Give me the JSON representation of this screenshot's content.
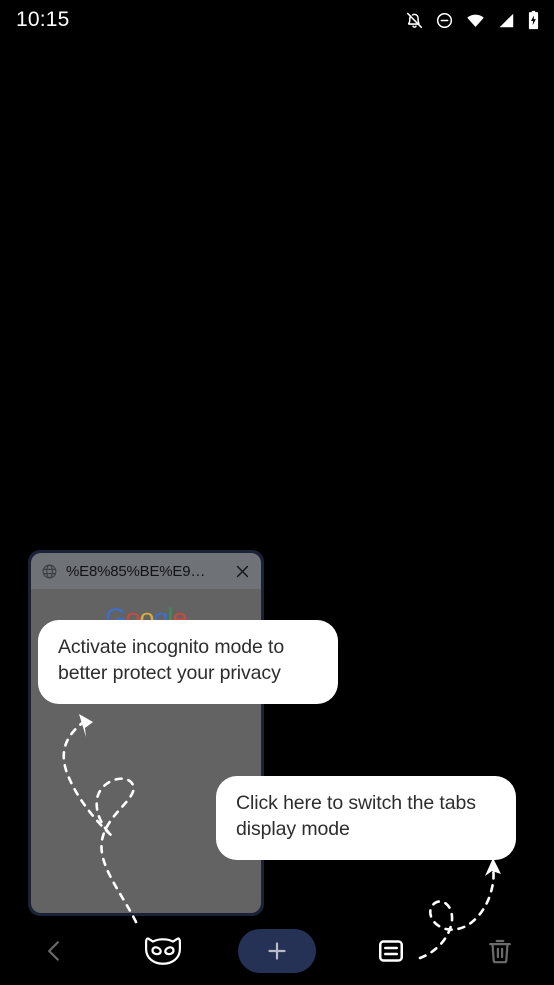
{
  "status_bar": {
    "time": "10:15",
    "icons": [
      {
        "name": "notifications-off-icon",
        "label": "Notifications silenced"
      },
      {
        "name": "do-not-disturb-icon",
        "label": "Do not disturb"
      },
      {
        "name": "wifi-icon",
        "label": "Wi-Fi full signal"
      },
      {
        "name": "cellular-signal-icon",
        "label": "Cellular signal"
      },
      {
        "name": "battery-charging-icon",
        "label": "Battery charging"
      }
    ]
  },
  "tab_card": {
    "favicon": "globe-icon",
    "title": "%E8%85%BE%E9…",
    "close_label": "✕",
    "thumbnail": {
      "logo_letters": [
        {
          "char": "G",
          "color": "#3b6fd4"
        },
        {
          "char": "o",
          "color": "#d0483c"
        },
        {
          "char": "o",
          "color": "#e0b33a"
        },
        {
          "char": "g",
          "color": "#3b6fd4"
        },
        {
          "char": "l",
          "color": "#3f9157"
        },
        {
          "char": "e",
          "color": "#d0483c"
        }
      ],
      "logo_subtext": "",
      "background_color": "#636363"
    },
    "border_color": "#1b2238",
    "header_color": "#6f7277"
  },
  "tooltips": [
    {
      "id": "incognito",
      "text": "Activate incognito mode to better protect your privacy",
      "background": "#ffffff",
      "text_color": "#2d2d2d",
      "points_to": "incognito-mode-button"
    },
    {
      "id": "tabs_display_mode",
      "text": "Click here to switch the tabs display mode",
      "background": "#ffffff",
      "text_color": "#2d2d2d",
      "points_to": "tabs-display-mode-button"
    }
  ],
  "bottom_toolbar": {
    "buttons": [
      {
        "name": "back-button",
        "icon": "chevron-left-icon",
        "color": "#6b6b6b",
        "label": "Back"
      },
      {
        "name": "incognito-mode-button",
        "icon": "incognito-mask-icon",
        "color": "#ffffff",
        "label": "Incognito mode"
      },
      {
        "name": "new-tab-button",
        "icon": "plus-icon",
        "color": "#b9bcc6",
        "background": "#263255",
        "label": "New tab"
      },
      {
        "name": "tabs-display-mode-button",
        "icon": "tabs-list-icon",
        "color": "#ffffff",
        "label": "Tabs display mode"
      },
      {
        "name": "close-all-tabs-button",
        "icon": "trash-icon",
        "color": "#6b6b6b",
        "label": "Close all tabs"
      }
    ]
  },
  "arrows": [
    {
      "name": "arrow-to-incognito",
      "color": "#ffffff",
      "style": "dashed-loop",
      "direction": "up-left"
    },
    {
      "name": "arrow-to-tabs-mode",
      "color": "#ffffff",
      "style": "dashed-loop",
      "direction": "up"
    }
  ],
  "background_color": "#000000"
}
